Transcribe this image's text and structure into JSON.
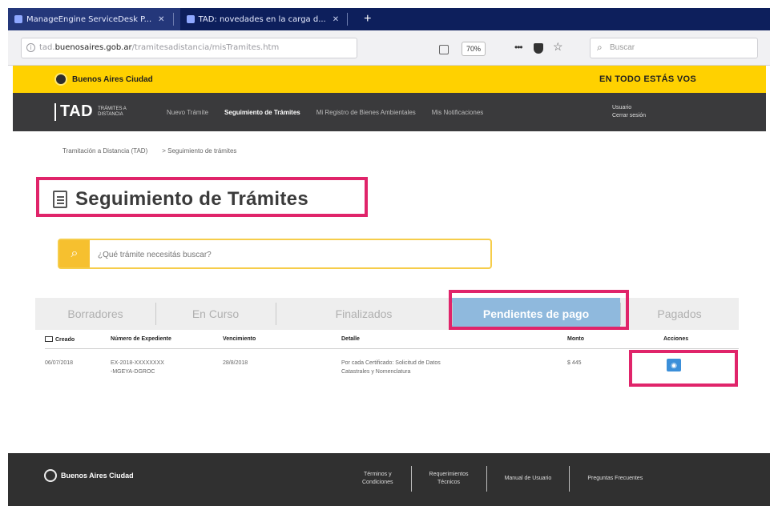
{
  "browser": {
    "tabs": [
      {
        "label": "ManageEngine ServiceDesk P...",
        "active": true
      },
      {
        "label": "TAD: novedades en la carga d...",
        "active": false
      }
    ],
    "new_tab_label": "+",
    "url_prefix": "tad.",
    "url_domain": "buenosaires.gob.ar",
    "url_path": "/tramitesadistancia/misTramites.htm",
    "zoom": "70%",
    "search_placeholder": "Buscar"
  },
  "city_bar": {
    "logo_text": "Buenos Aires Ciudad",
    "slogan": "EN TODO ESTÁS VOS"
  },
  "tad_nav": {
    "logo_word": "TAD",
    "logo_sub": "TRÁMITES A DISTANCIA",
    "items": [
      {
        "label": "Nuevo Trámite",
        "current": false
      },
      {
        "label": "Seguimiento de Trámites",
        "current": true
      },
      {
        "label": "Mi Registro de Bienes Ambientales",
        "current": false
      },
      {
        "label": "Mis Notificaciones",
        "current": false
      }
    ],
    "user_line1": "Usuario",
    "user_line2": "Cerrar sesión"
  },
  "breadcrumb": {
    "items": [
      "Tramitación a Distancia (TAD)",
      "> Seguimiento de trámites"
    ]
  },
  "page": {
    "title": "Seguimiento de Trámites"
  },
  "search": {
    "placeholder": "¿Qué trámite necesitás buscar?"
  },
  "tabs": [
    {
      "label": "Borradores",
      "active": false
    },
    {
      "label": "En Curso",
      "active": false
    },
    {
      "label": "Finalizados",
      "active": false
    },
    {
      "label": "Pendientes de pago",
      "active": true
    },
    {
      "label": "Pagados",
      "active": false
    }
  ],
  "table": {
    "columns": [
      "Creado",
      "Número de Expediente",
      "Vencimiento",
      "Detalle",
      "Monto",
      "Acciones"
    ],
    "rows": [
      {
        "created": "06/07/2018",
        "expediente_l1": "EX-2018-XXXXXXXX",
        "expediente_l2": "-MGEYA-DGROC",
        "vencimiento": "28/8/2018",
        "detalle_l1": "Por cada Certificado: Solicitud de Datos",
        "detalle_l2": "Catastrales y Nomenclatura",
        "monto": "$ 445"
      }
    ]
  },
  "footer": {
    "logo_text": "Buenos Aires Ciudad",
    "links": [
      {
        "l1": "Términos y",
        "l2": "Condiciones"
      },
      {
        "l1": "Requerimientos",
        "l2": "Técnicos"
      },
      {
        "l1": "Manual de Usuario",
        "l2": ""
      },
      {
        "l1": "Preguntas Frecuentes",
        "l2": ""
      }
    ]
  },
  "colors": {
    "highlight": "#e0246a",
    "city_yellow": "#ffd100",
    "active_tab": "#8fb9dd",
    "action_blue": "#3b8fd9",
    "nav_dark": "#3a3a3c"
  },
  "icons": [
    "favicon-icon",
    "info-icon",
    "reader-icon",
    "shield-icon",
    "star-icon",
    "search-icon",
    "document-icon",
    "calendar-icon",
    "eye-icon",
    "city-emblem-icon"
  ]
}
